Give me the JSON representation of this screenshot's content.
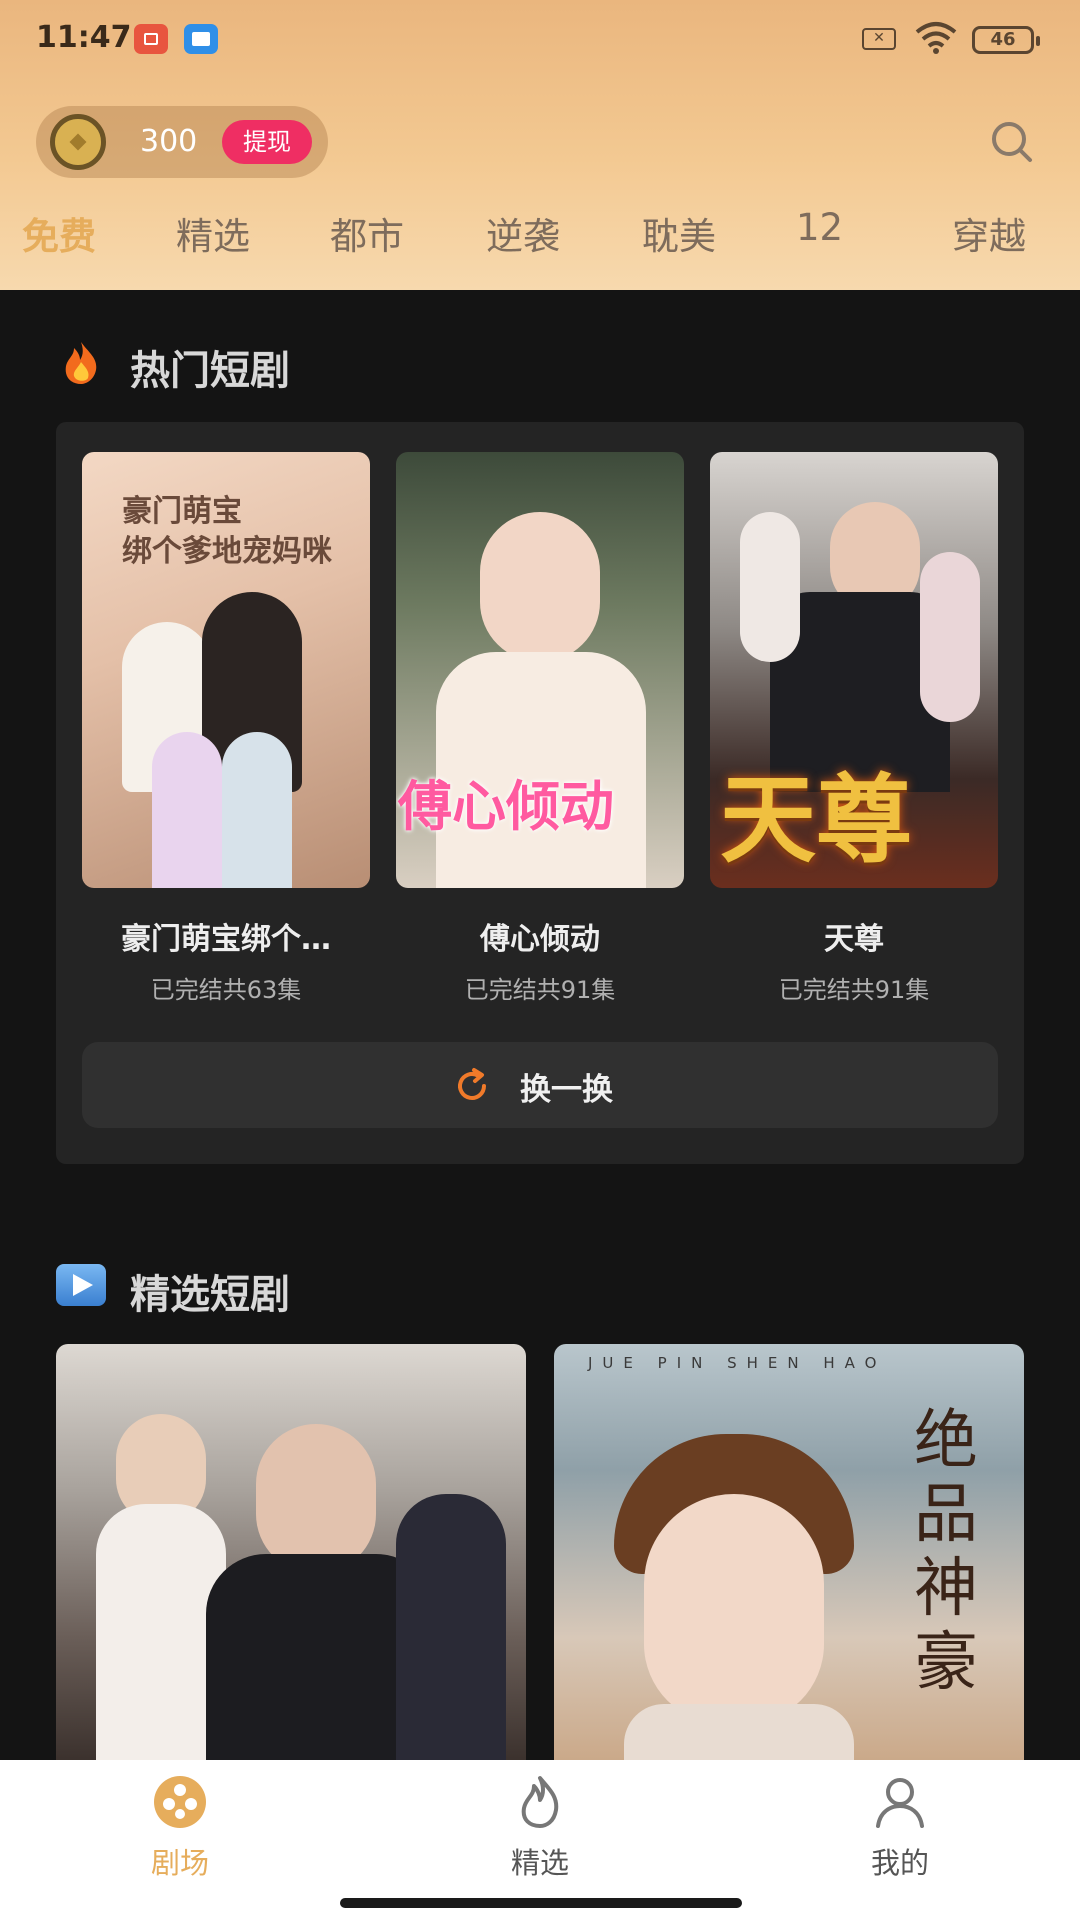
{
  "status_bar": {
    "time": "11:47",
    "sim_label": "✕",
    "battery": "46"
  },
  "header": {
    "coins": "300",
    "withdraw_label": "提现"
  },
  "tabs": [
    {
      "label": "免费",
      "active": true
    },
    {
      "label": "精选"
    },
    {
      "label": "都市"
    },
    {
      "label": "逆袭"
    },
    {
      "label": "耽美"
    },
    {
      "label": "12"
    },
    {
      "label": "穿越"
    }
  ],
  "hot_section": {
    "title": "热门短剧",
    "items": [
      {
        "title": "豪门萌宝绑个…",
        "subtitle": "已完结共63集",
        "poster_caption": "豪门萌宝\n绑个爹地宠妈咪"
      },
      {
        "title": "傅心倾动",
        "subtitle": "已完结共91集",
        "poster_caption": "傅心倾动"
      },
      {
        "title": "天尊",
        "subtitle": "已完结共91集",
        "poster_caption": "天尊"
      }
    ],
    "refresh_label": "换一换"
  },
  "featured_section": {
    "title": "精选短剧",
    "items": [
      {
        "poster_caption": ""
      },
      {
        "poster_caption": "绝品神豪",
        "poster_subcaption": "JUE PIN SHEN HAO"
      }
    ]
  },
  "bottom_nav": [
    {
      "label": "剧场",
      "icon": "film-reel-icon",
      "active": true
    },
    {
      "label": "精选",
      "icon": "flame-icon"
    },
    {
      "label": "我的",
      "icon": "person-icon"
    }
  ],
  "colors": {
    "accent": "#e6ad5c",
    "withdraw": "#ef2e63",
    "bg": "#141414"
  }
}
